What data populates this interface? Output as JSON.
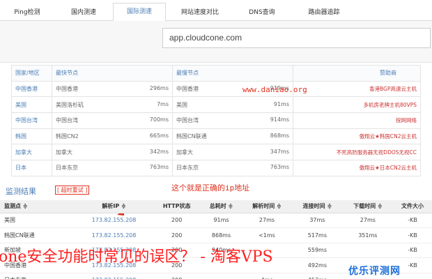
{
  "tabs": [
    "Ping检测",
    "国内测速",
    "国际测速",
    "网站速度对比",
    "DNS查询",
    "路由器追踪"
  ],
  "url_input": {
    "value": "app.cloudcone.com"
  },
  "node_table": {
    "headers": [
      "国家/地区",
      "最快节点",
      "最慢节点",
      "赞助商"
    ],
    "rows": [
      {
        "region": "中国香港",
        "fast": "中国香港",
        "fast_t": "296ms",
        "slow": "中国香港",
        "slow_t": "919ms",
        "sponsor": "香港BGP高速云主机"
      },
      {
        "region": "美国",
        "fast": "美国洛杉矶",
        "fast_t": "7ms",
        "slow": "美国",
        "slow_t": "91ms",
        "sponsor": "多机房老牌主机80VPS"
      },
      {
        "region": "中国台湾",
        "fast": "中国台湾",
        "fast_t": "700ms",
        "slow": "中国台湾",
        "slow_t": "914ms",
        "sponsor": "锐网网络"
      },
      {
        "region": "韩国",
        "fast": "韩国CN2",
        "fast_t": "665ms",
        "slow": "韩国CN联通",
        "slow_t": "868ms",
        "sponsor": "傲翔云★韩国CN2云主机"
      },
      {
        "region": "加拿大",
        "fast": "加拿大",
        "fast_t": "342ms",
        "slow": "加拿大",
        "slow_t": "347ms",
        "sponsor": "不死高防服务器无视DDOS无视CC"
      },
      {
        "region": "日本",
        "fast": "日本东京",
        "fast_t": "763ms",
        "slow": "日本东京",
        "slow_t": "763ms",
        "sponsor": "傲翔云★日本CN2云主机"
      }
    ]
  },
  "annotations": {
    "site_url": "www.daniao.org",
    "ip_note": "这个就是正确的ip地址"
  },
  "monitor": {
    "title": "监测结果",
    "retest": "[ 超时重试 ]",
    "headers": [
      "监测点 ≑",
      "解析IP ≑",
      "HTTP状态",
      "总耗时 ≑",
      "解析时间 ≑",
      "连接时间 ≑",
      "下载时间 ≑",
      "文件大小"
    ],
    "rows": [
      {
        "node": "美国",
        "ip": "173.82.155.208",
        "status": "200",
        "total": "91ms",
        "dns": "27ms",
        "conn": "37ms",
        "dl": "27ms",
        "size": "-KB"
      },
      {
        "node": "韩国CN联通",
        "ip": "173.82.155.208",
        "status": "200",
        "total": "868ms",
        "dns": "<1ms",
        "conn": "517ms",
        "dl": "351ms",
        "size": "-KB"
      },
      {
        "node": "新加坡",
        "ip": "173.82.155.208",
        "status": "200",
        "total": "940ms",
        "dns": "",
        "conn": "559ms",
        "dl": "",
        "size": "-KB"
      },
      {
        "node": "中国香港",
        "ip": "173.82.155.208",
        "status": "200",
        "total": "",
        "dns": "",
        "conn": "492ms",
        "dl": "",
        "size": "-KB"
      },
      {
        "node": "日本东京",
        "ip": "173.82.155.208",
        "status": "200",
        "total": "",
        "dns": "4ms",
        "conn": "453ms",
        "dl": "",
        "size": ""
      }
    ]
  },
  "watermark": {
    "caption": "one安全功能时常见的误区？ - 淘客VPS",
    "logo": "优乐评测网"
  }
}
